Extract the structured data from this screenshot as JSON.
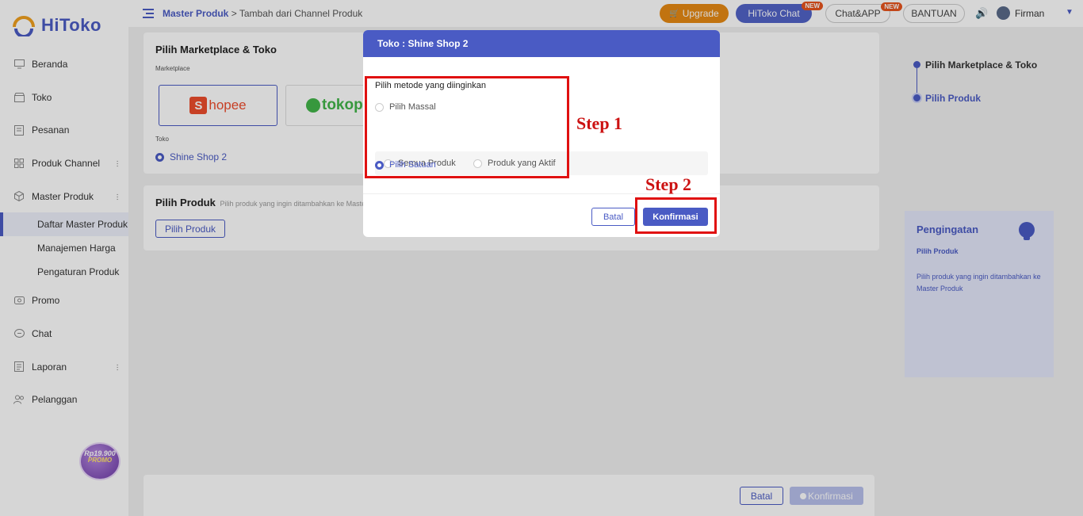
{
  "app": {
    "name": "HiToko"
  },
  "sidebar": {
    "items": [
      {
        "label": "Beranda",
        "icon": "monitor-icon"
      },
      {
        "label": "Toko",
        "icon": "store-icon"
      },
      {
        "label": "Pesanan",
        "icon": "list-icon"
      },
      {
        "label": "Produk Channel",
        "icon": "grid-icon"
      },
      {
        "label": "Master Produk",
        "icon": "box-icon"
      }
    ],
    "sub_items": [
      {
        "label": "Daftar Master Produk",
        "active": true
      },
      {
        "label": "Manajemen Harga"
      },
      {
        "label": "Pengaturan Produk"
      }
    ],
    "items_after": [
      {
        "label": "Promo",
        "icon": "tag-icon"
      },
      {
        "label": "Chat",
        "icon": "chat-icon"
      },
      {
        "label": "Laporan",
        "icon": "report-icon"
      },
      {
        "label": "Pelanggan",
        "icon": "users-icon"
      }
    ],
    "promo": {
      "price": "Rp19.900",
      "label": "PROMO"
    }
  },
  "header": {
    "breadcrumb_root": "Master Produk",
    "breadcrumb_sep": ">",
    "breadcrumb_current": "Tambah dari Channel Produk",
    "upgrade_label": "Upgrade",
    "hitoko_chat_label": "HiToko Chat",
    "chat_app_label": "Chat&APP",
    "bantuan_label": "BANTUAN",
    "new_badge": "NEW",
    "user_name": "Firman"
  },
  "main": {
    "section1_title": "Pilih Marketplace & Toko",
    "marketplace_label": "Marketplace",
    "marketplaces": [
      "Shopee",
      "tokopedia"
    ],
    "shopee_text": "hopee",
    "tokopedia_text": "tokope",
    "toko_label": "Toko",
    "selected_store": "Shine Shop 2",
    "section2_title": "Pilih Produk",
    "section2_hint": "Pilih produk yang ingin ditambahkan ke Master Produk",
    "pilih_produk_button": "Pilih Produk"
  },
  "steps": [
    {
      "label": "Pilih Marketplace & Toko"
    },
    {
      "label": "Pilih Produk"
    }
  ],
  "reminder": {
    "title": "Pengingatan",
    "subtitle": "Pilih Produk",
    "description": "Pilih produk yang ingin ditambahkan ke Master Produk"
  },
  "bottom_bar": {
    "cancel_label": "Batal",
    "confirm_label": "Konfirmasi"
  },
  "modal": {
    "title": "Toko : Shine Shop 2",
    "method_label": "Pilih metode yang diinginkan",
    "options": [
      {
        "label": "Pilih Massal",
        "selected": false
      },
      {
        "label": "Pilih Satuan",
        "selected": true
      }
    ],
    "sub_options": [
      {
        "label": "Semua Produk",
        "selected": false
      },
      {
        "label": "Produk yang Aktif",
        "selected": false
      }
    ],
    "cancel_label": "Batal",
    "confirm_label": "Konfirmasi"
  },
  "annotations": {
    "step1": "Step 1",
    "step2": "Step 2"
  },
  "colors": {
    "primary": "#4a5bc4",
    "upgrade": "#e68a14",
    "annotation": "#e01010",
    "shopee": "#ee4d2d",
    "tokopedia": "#42b549"
  }
}
